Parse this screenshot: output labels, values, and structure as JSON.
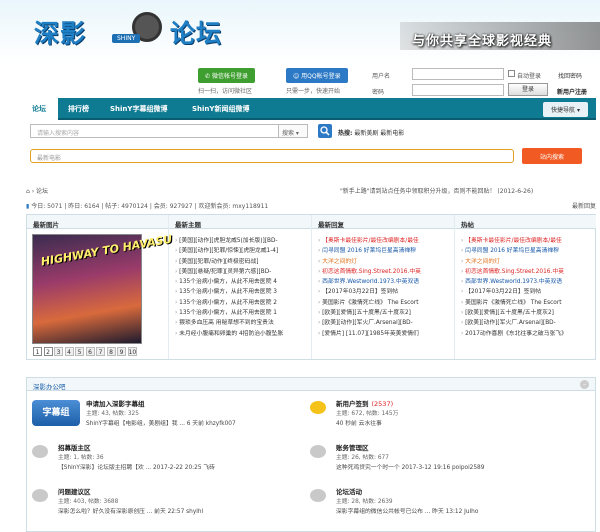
{
  "banner": {
    "logo_left": "深影",
    "logo_right": "论坛",
    "shiny": "SHINY",
    "slogan": "与你共享全球影视经典"
  },
  "login": {
    "wechat_btn": "微信帐号登录",
    "wechat_hint": "扫一扫，访问微社区",
    "qq_btn": "用QQ帐号登录",
    "qq_hint": "只需一步，快速开始",
    "username_label": "用户名",
    "password_label": "密码",
    "auto_login": "自动登录",
    "find_password": "找回密码",
    "login_btn": "登录",
    "register": "新用户注册"
  },
  "nav": {
    "items": [
      "论坛",
      "排行榜",
      "ShinY字幕组微博",
      "ShinY新闻组微博"
    ],
    "quick": "快捷导航"
  },
  "search": {
    "placeholder": "请输入搜索内容",
    "type": "搜索",
    "hot_label": "热搜:",
    "hot_1": "最新美剧",
    "hot_2": "最新电影",
    "movie_placeholder": "最新电影",
    "station_btn": "站内搜索"
  },
  "crumb": "论坛",
  "notice": "\"新手上路\"请到站点任务中领取积分升级，否则不能回贴！ (2012-6-26)",
  "stats": "今日: 5071 | 昨日: 6164 | 帖子: 4970124 | 会员: 927927 | 欢迎新会员: mxy118911",
  "latest_reply": "最新回复",
  "columns": {
    "pic_title": "最新图片",
    "new_title": "最新主题",
    "reply_title": "最新回复",
    "hot_title": "热帖",
    "poster_text": "HIGHWAY TO HAVASU",
    "pages": [
      "1",
      "2",
      "3",
      "4",
      "5",
      "6",
      "7",
      "8",
      "9",
      "10"
    ],
    "new_items": [
      "[美国][动作][虎胆龙威5(加长版)][BD-",
      "[美国][动作][犯罪/惊悚][虎胆龙威1-4]",
      "[美国][犯罪/动作][终极密码战]",
      "[美国][悬疑/犯罪][灵异第六感][BD-",
      "135个治病小偏方，从此不用去医院 4",
      "135个治病小偏方，从此不用去医院 3",
      "135个治病小偏方，从此不用去医院 2",
      "135个治病小偏方，从此不用去医院 1",
      "猥琐多血压高 用秘草想不到的宝贵法",
      "未月经小腹痛和卵巢的 4招防治小腹坠胀"
    ],
    "reply_items": [
      "【奥斯卡最佳影片/最佳改编剧本/最佳",
      "闫寻同盟 2016 好莱坞巨星高清禅穆",
      "大洋之间的灯",
      "初恋这首情歌.Sing.Street.2016.中英",
      "西部世界.Westworld.1973.中英双语",
      "【2017年03月22日】签到帖",
      "美国影片《激情死亡线》 The Escort",
      "[欧美][爱情][五十度黑/五十度灰2]",
      "[欧美][动作][军火厂.Arsenal][BD-",
      "[爱情片] [11.07][1985年英美爱情们"
    ],
    "hot_items": [
      "【奥斯卡最佳影片/最佳改编剧本/最佳",
      "闫寻同盟 2016 好莱坞巨星高清禅穆",
      "大洋之间的灯",
      "初恋这首情歌.Sing.Street.2016.中英",
      "西部世界.Westworld.1973.中英双语",
      "【2017年03月22日】签到帖",
      "美国影片《激情死亡线》 The Escort",
      "[欧美][爱情][五十度黑/五十度灰2]",
      "[欧美][动作][军火厂.Arsenal][BD-",
      "2017动作喜剧《东北往事之破马张飞》"
    ]
  },
  "section": {
    "title": "深影办公吧",
    "forums": [
      {
        "name": "申请加入深影字幕组",
        "stat": "主题: 43, 帖数: 325",
        "last": "ShinY字幕组【电影组，美剧组】我 ... 6 天前 khzyfk007",
        "logo": "字幕组"
      },
      {
        "name": "新用户签到",
        "count": "(2537)",
        "stat": "主题: 672, 帖数: 145万",
        "last": "40 秒前 云水往事"
      },
      {
        "name": "招募版主区",
        "stat": "主题: 1, 帖数: 36",
        "last": "【ShinY深影】论坛版主招聘【欢 ... 2017-2-22 20:25 飞砖"
      },
      {
        "name": "账务管理区",
        "stat": "主题: 26, 帖数: 677",
        "last": "这种死鸡贷究一个时一个 2017-3-12 19:16 poipoi2589"
      },
      {
        "name": "问题建议区",
        "stat": "主题: 403, 帖数: 3688",
        "last": "深影怎么啦？好久没有深影原创压 ... 前天 22:57 shylhl"
      },
      {
        "name": "论坛活动",
        "stat": "主题: 28, 帖数: 2639",
        "last": "深影字幕组的微信公共帐号已公布 ... 昨天 13:12 Julho"
      }
    ]
  },
  "colors": {
    "nav": "#0f7b92",
    "accent": "#2c79c5",
    "search_btn": "#f15a22",
    "green": "#3e9e2f"
  }
}
